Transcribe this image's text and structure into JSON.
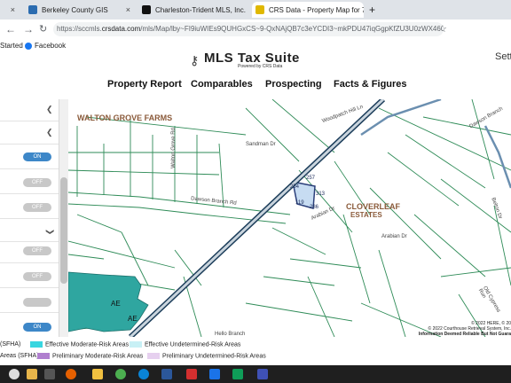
{
  "browser": {
    "tabs": [
      {
        "label": "Berkeley County GIS"
      },
      {
        "label": "Charleston-Trident MLS, Inc."
      },
      {
        "label": "CRS Data - Property Map for 7"
      }
    ],
    "close_glyph": "×",
    "new_tab_glyph": "+",
    "url_prefix": "https://sccmls.",
    "url_domain": "crsdata.com",
    "url_rest": "/mls/Map/lby~FI9iuWIEs9QUHGxCS~9-QxNAjQB7c3eYCDI3~mkPDU47iqGgpKfZU3U0zWX460n",
    "bookmarks": [
      "Started",
      "Facebook"
    ]
  },
  "app": {
    "logo_text": "MLS Tax Suite",
    "logo_sub": "Powered by CRS Data",
    "settings_partial": "Sett",
    "nav": [
      "Property Report",
      "Comparables",
      "Prospecting",
      "Facts & Figures"
    ]
  },
  "left_panel": {
    "toggles": [
      "ON",
      "OFF",
      "OFF",
      "OFF",
      "OFF",
      "ON"
    ]
  },
  "map": {
    "labels": {
      "walton": "WALTON GROVE FARMS",
      "cloverleaf1": "CLOVERLEAF",
      "cloverleaf2": "ESTATES",
      "ae1": "AE",
      "ae2": "AE"
    },
    "roads": [
      "Dawson Branch Rd",
      "Sandman Dr",
      "Walton Grove Rd",
      "Arabian Dr",
      "Arabian Dr",
      "Woodpatch Hill Ln",
      "Dawson Branch",
      "Old Cypress Run",
      "Hello Branch",
      "Belton Dr"
    ],
    "parcel_dims": [
      "254",
      "257",
      "313",
      "119",
      "286"
    ],
    "copyright1": "© 2022 HERE, © 20",
    "copyright2": "© 2022 Courthouse Retrieval System, Inc.",
    "disclaimer": "Information Deemed Reliable But Not Guara"
  },
  "legend": {
    "row1": [
      {
        "label": "(SFHA)",
        "color": ""
      },
      {
        "label": "Effective Moderate-Risk Areas",
        "color": "#38d6e0"
      },
      {
        "label": "Effective Undetermined-Risk Areas",
        "color": "#c8f0f5"
      }
    ],
    "row2": [
      {
        "label": "Areas (SFHA)",
        "color": ""
      },
      {
        "label": "Preliminary Moderate-Risk Areas",
        "color": "#b07fcf"
      },
      {
        "label": "Preliminary Undetermined-Risk Areas",
        "color": "#e6d0ef"
      }
    ]
  },
  "colors": {
    "flood_zone": "#2fa6a0",
    "parcel_lines": "#2e8b57",
    "highway": "#1c3d5a",
    "selected_parcel": "#c7dcf2"
  }
}
